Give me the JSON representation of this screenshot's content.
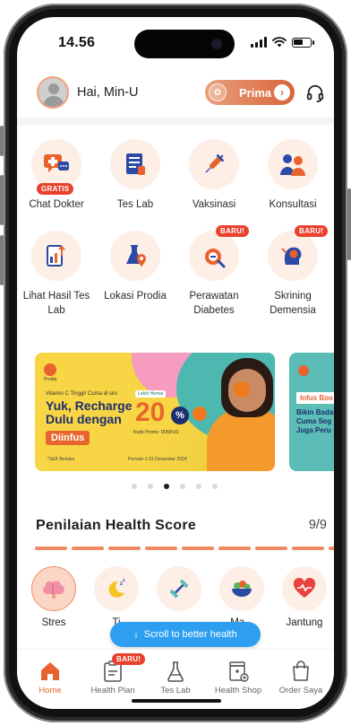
{
  "status_bar": {
    "time": "14.56"
  },
  "header": {
    "greeting": "Hai, Min-U",
    "prima_label": "Prima",
    "prima_arrow": "›"
  },
  "services": [
    {
      "label": "Chat Dokter",
      "tag": "GRATIS",
      "icon": "chat-doctor-icon"
    },
    {
      "label": "Tes Lab",
      "tag": "",
      "icon": "lab-test-icon"
    },
    {
      "label": "Vaksinasi",
      "tag": "",
      "icon": "syringe-icon"
    },
    {
      "label": "Konsultasi",
      "tag": "",
      "icon": "consultation-icon"
    },
    {
      "label": "Lihat Hasil Tes Lab",
      "tag": "",
      "icon": "lab-result-icon"
    },
    {
      "label": "Lokasi Prodia",
      "tag": "",
      "icon": "location-flask-icon"
    },
    {
      "label": "Perawatan Diabetes",
      "tag": "BARU!",
      "icon": "diabetes-icon"
    },
    {
      "label": "Skrining Demensia",
      "tag": "BARU!",
      "icon": "dementia-icon"
    }
  ],
  "banner_main": {
    "logo_text": "Prodia",
    "small_text": "Vitamin C Tinggi! Cuma di sini",
    "headline_1": "Yuk, Recharge",
    "headline_2": "Dulu dengan",
    "cta": "Diinfus",
    "promo_tag": "Lebih Hemat",
    "percent": "20",
    "percent_sign": "%",
    "code_text": "Kode Promo: DIINFUS",
    "fine_1": "*S&K Berlaku",
    "fine_2": "Periode 1-31 Desember 2024"
  },
  "banner_next": {
    "title": "Infus Boo",
    "line_1": "Bikin Bada",
    "line_2": "Cuma Seg",
    "line_3": "Juga Peru"
  },
  "carousel": {
    "count": 6,
    "active_index": 2
  },
  "health_score": {
    "title": "Penilaian Health Score",
    "count": "9/9",
    "segments": 9
  },
  "metrics": [
    {
      "label": "Stres",
      "icon": "brain-icon",
      "selected": true
    },
    {
      "label": "Ti",
      "icon": "sleep-moon-icon",
      "selected": false
    },
    {
      "label": "",
      "icon": "fitness-dumbbell-icon",
      "selected": false
    },
    {
      "label": "Ma...",
      "icon": "food-bowl-icon",
      "selected": false
    },
    {
      "label": "Jantung",
      "icon": "heart-icon",
      "selected": false
    }
  ],
  "scroll_pill": {
    "label": "Scroll to better health",
    "arrow": "↓"
  },
  "nav": [
    {
      "label": "Home",
      "active": true,
      "tag": ""
    },
    {
      "label": "Health Plan",
      "active": false,
      "tag": "BARU!"
    },
    {
      "label": "Tes Lab",
      "active": false,
      "tag": ""
    },
    {
      "label": "Health Shop",
      "active": false,
      "tag": ""
    },
    {
      "label": "Order Saya",
      "active": false,
      "tag": ""
    }
  ],
  "colors": {
    "accent": "#e8622e",
    "accent_light": "#fdeee6",
    "badge_red": "#e8422e",
    "pill_blue": "#2d9ef0"
  }
}
